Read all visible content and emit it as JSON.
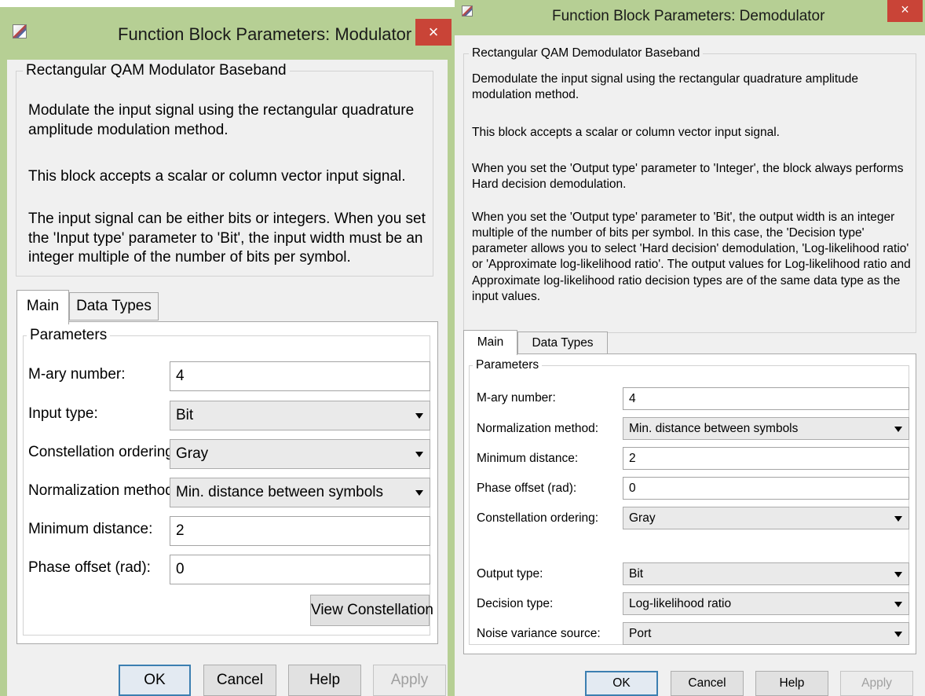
{
  "modulator": {
    "title": "Function Block Parameters: Modulator",
    "close_glyph": "×",
    "block_name": "Rectangular QAM Modulator Baseband",
    "description": [
      "Modulate the input signal using the rectangular quadrature amplitude modulation method.",
      "This block accepts a scalar or column vector input signal.",
      "The input signal can be either bits or integers. When you set the 'Input type' parameter to 'Bit', the input width must be an integer multiple of the number of bits per symbol."
    ],
    "tabs": [
      "Main",
      "Data Types"
    ],
    "params_group": "Parameters",
    "params": [
      {
        "label": "M-ary number:",
        "value": "4"
      },
      {
        "label": "Input type:",
        "value": "Bit"
      },
      {
        "label": "Constellation ordering:",
        "value": "Gray"
      },
      {
        "label": "Normalization method:",
        "value": "Min. distance between symbols"
      },
      {
        "label": "Minimum distance:",
        "value": "2"
      },
      {
        "label": "Phase offset (rad):",
        "value": "0"
      }
    ],
    "view_constellation": "View Constellation",
    "buttons": {
      "ok": "OK",
      "cancel": "Cancel",
      "help": "Help",
      "apply": "Apply"
    }
  },
  "demodulator": {
    "title": "Function Block Parameters: Demodulator",
    "close_glyph": "×",
    "block_name": "Rectangular QAM Demodulator Baseband",
    "description": [
      "Demodulate the input signal using the rectangular quadrature amplitude modulation method.",
      "This block accepts a scalar or column vector input signal.",
      "When you set the 'Output type' parameter to 'Integer', the block always performs Hard decision demodulation.",
      "When you set the 'Output type' parameter to 'Bit', the output width is an integer multiple of the number of bits per symbol. In this case, the 'Decision type' parameter allows you to select 'Hard decision' demodulation, 'Log-likelihood ratio' or 'Approximate log-likelihood ratio'. The output values for Log-likelihood ratio and Approximate log-likelihood ratio decision types are of the same data type as the input values."
    ],
    "tabs": [
      "Main",
      "Data Types"
    ],
    "params_group": "Parameters",
    "params": [
      {
        "label": "M-ary number:",
        "value": "4"
      },
      {
        "label": "Normalization method:",
        "value": "Min. distance between symbols"
      },
      {
        "label": "Minimum distance:",
        "value": "2"
      },
      {
        "label": "Phase offset (rad):",
        "value": "0"
      },
      {
        "label": "Constellation ordering:",
        "value": "Gray"
      },
      {
        "label": "Output type:",
        "value": "Bit"
      },
      {
        "label": "Decision type:",
        "value": "Log-likelihood ratio"
      },
      {
        "label": "Noise variance source:",
        "value": "Port"
      }
    ],
    "buttons": {
      "ok": "OK",
      "cancel": "Cancel",
      "help": "Help",
      "apply": "Apply"
    }
  },
  "colors": {
    "title_bar": "#b6cf94",
    "dialog_body": "#f0f0f0",
    "close_button": "#c94437",
    "default_button_border": "#3c7fb1"
  }
}
